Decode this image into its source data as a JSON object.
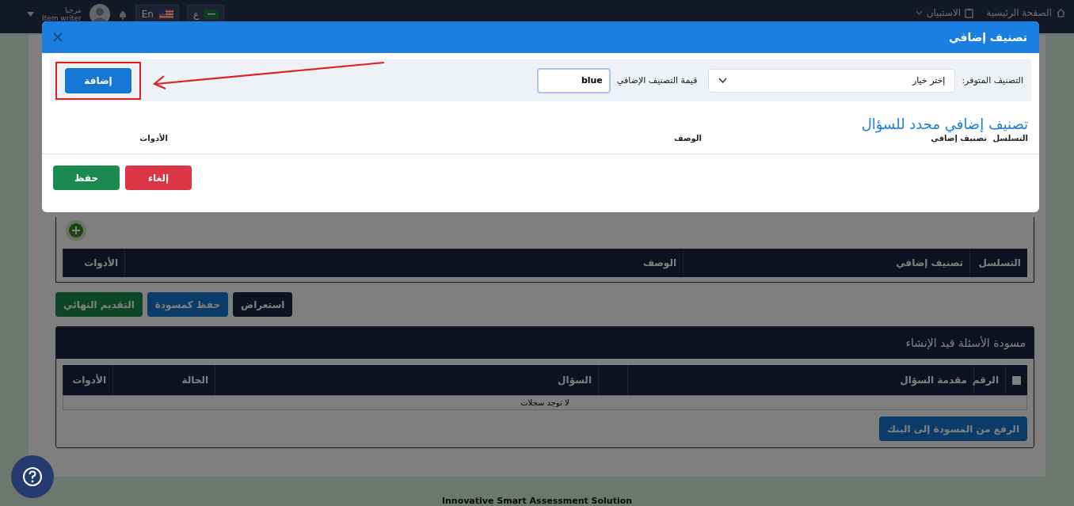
{
  "header": {
    "nav": [
      {
        "label": "الصفحة الرئيسية",
        "kind": "home"
      },
      {
        "label": "الاستبيان",
        "kind": "menu"
      }
    ],
    "languages": [
      {
        "label": "ع",
        "kind": "sa"
      },
      {
        "label": "En",
        "kind": "us"
      }
    ],
    "user": {
      "greeting": "مرحبا",
      "role": "Item writer"
    }
  },
  "page": {
    "classification_table": {
      "columns": [
        "التسلسل",
        "تصنيف إضافي",
        "الوصف",
        "الأدوات"
      ]
    },
    "actions": [
      {
        "label": "استعراض",
        "kind": "dark"
      },
      {
        "label": "حفظ كمسودة",
        "kind": "primary"
      },
      {
        "label": "التقديم النهائي",
        "kind": "success"
      }
    ],
    "drafts": {
      "title": "مسودة الأسئلة قيد الإنشاء",
      "checked": false,
      "columns": [
        "الرقم",
        "مقدمة السؤال",
        "",
        "السؤال",
        "الحالة",
        "الأدوات"
      ],
      "empty_text": "لا توجد سجلات",
      "upload_button": "الرفع من المسودة إلى البنك"
    }
  },
  "footer": "Innovative Smart Assessment Solution",
  "modal": {
    "title": "تصنيف إضافي",
    "available_label": "التصنيف المتوفر:",
    "select_placeholder": "إختر خيار",
    "value_label": "قيمة التصنيف الإضافي",
    "value": "blue",
    "add_button": "إضافة",
    "highlight_add_button": true,
    "section_title": "تصنيف إضافي محدد للسؤال",
    "columns": [
      "التسلسل",
      "تصنيف إضافي",
      "الوصف",
      "الأدوات"
    ],
    "buttons": [
      {
        "label": "إلغاء",
        "kind": "danger"
      },
      {
        "label": "حفظ",
        "kind": "success"
      }
    ]
  }
}
